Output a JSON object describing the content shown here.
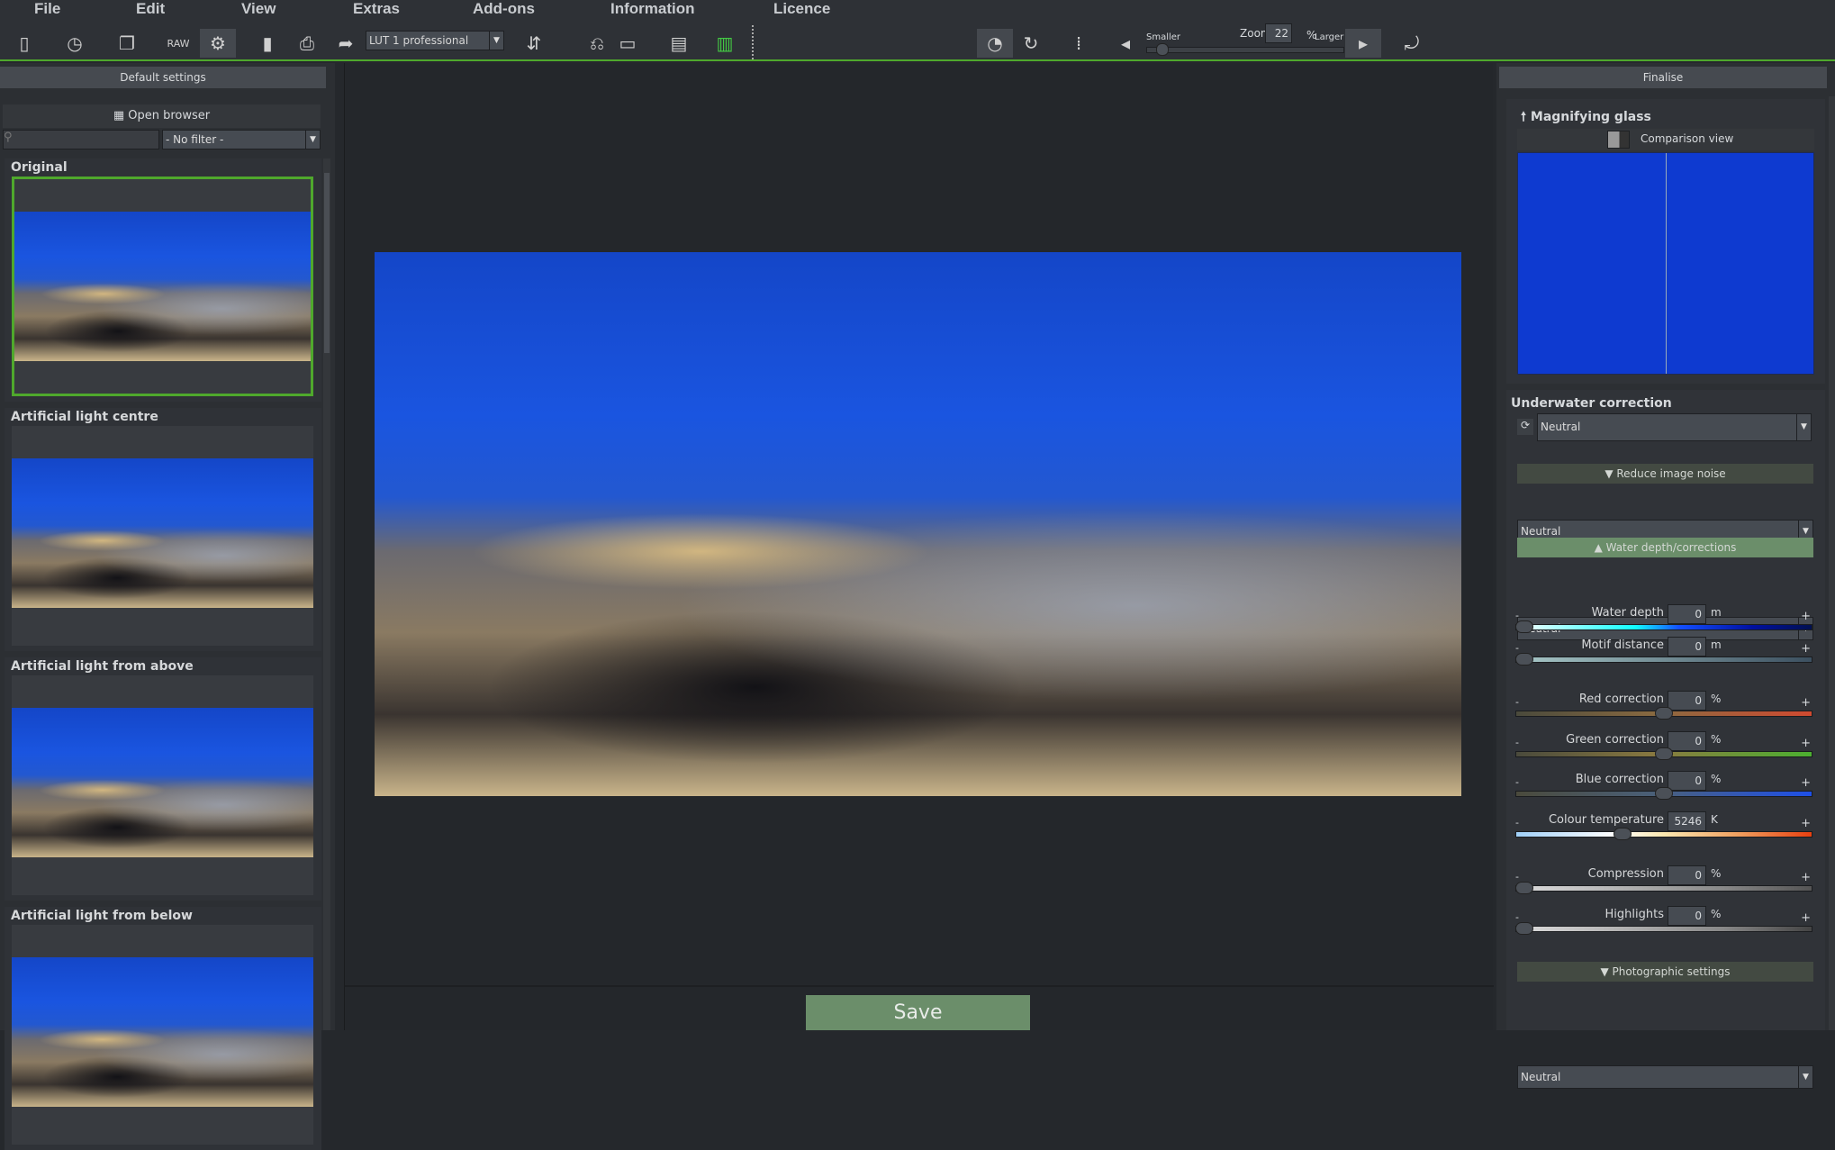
{
  "menu": [
    "File",
    "Edit",
    "View",
    "Extras",
    "Add-ons",
    "Information",
    "Licence"
  ],
  "toolbar": {
    "lut_value": "LUT 1 professional",
    "zoom_label": "Zoom",
    "zoom_value": "22",
    "zoom_unit": "%",
    "smaller": "Smaller",
    "larger": "Larger",
    "zoom_level_fraction": 0.05
  },
  "left": {
    "header": "Default settings",
    "open_browser": "Open browser",
    "filter": "- No filter -",
    "presets": [
      {
        "label": "Original",
        "selected": true
      },
      {
        "label": "Artificial light centre"
      },
      {
        "label": "Artificial light from above"
      },
      {
        "label": "Artificial light from below"
      }
    ]
  },
  "center": {
    "save": "Save"
  },
  "right": {
    "header": "Finalise",
    "magnifier": "Magnifying glass",
    "comparison": "Comparison view",
    "underwater": "Underwater correction",
    "underwater_preset": "Neutral",
    "noise": "Reduce image noise",
    "noise_preset": "Neutral",
    "depth": "Water depth/corrections",
    "depth_preset": "Neutral",
    "sliders": [
      {
        "name": "Water depth",
        "value": "0",
        "unit": "m",
        "level": 0
      },
      {
        "name": "Motif distance",
        "value": "0",
        "unit": "m",
        "level": 0
      },
      {
        "name": "Red correction",
        "value": "0",
        "unit": "%",
        "level": 0.5
      },
      {
        "name": "Green correction",
        "value": "0",
        "unit": "%",
        "level": 0.5
      },
      {
        "name": "Blue correction",
        "value": "0",
        "unit": "%",
        "level": 0.5
      },
      {
        "name": "Colour temperature",
        "value": "5246",
        "unit": "K",
        "level": 0.35
      },
      {
        "name": "Compression",
        "value": "0",
        "unit": "%",
        "level": 0
      },
      {
        "name": "Highlights",
        "value": "0",
        "unit": "%",
        "level": 0
      }
    ],
    "minus": "-",
    "plus": "+",
    "photo": "Photographic settings",
    "photo_preset": "Neutral"
  },
  "colors": {
    "accent": "#4fa82c",
    "save": "#6b8e6a"
  }
}
